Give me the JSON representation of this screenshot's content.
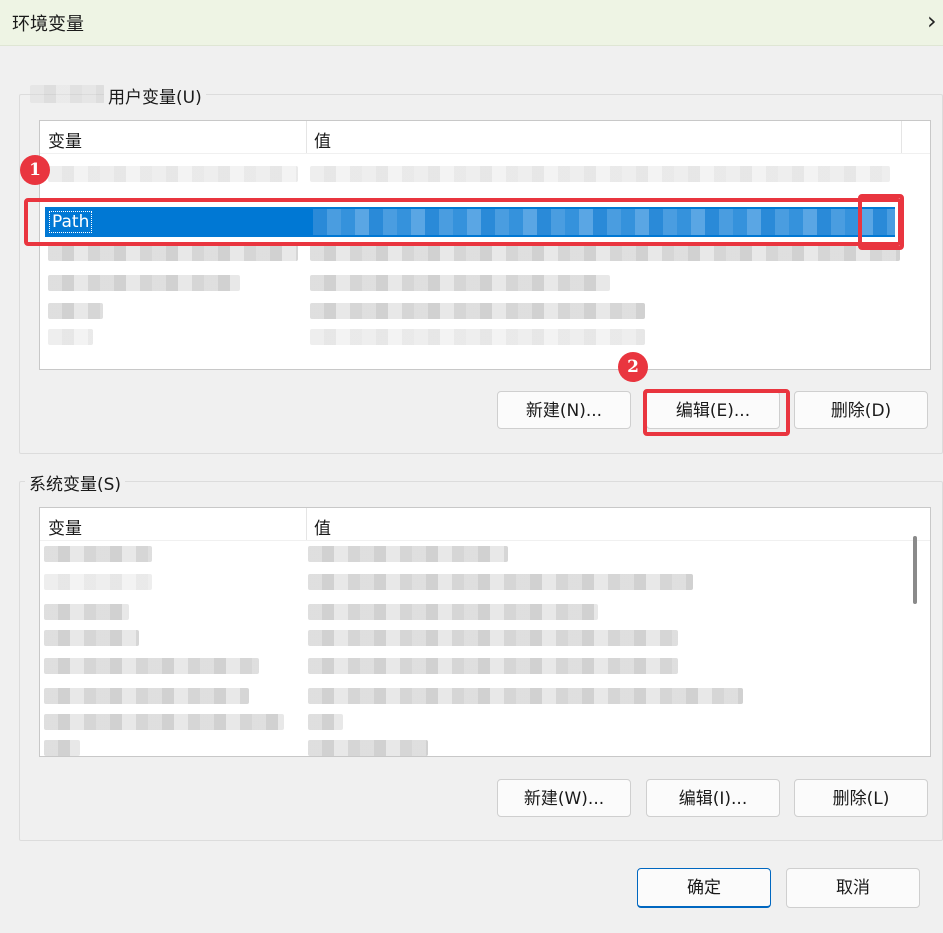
{
  "window": {
    "title": "环境变量"
  },
  "user_group": {
    "label": "用户变量(U)",
    "columns": [
      "变量",
      "值"
    ],
    "selected_variable": "Path",
    "buttons": {
      "new": "新建(N)...",
      "edit": "编辑(E)...",
      "delete": "删除(D)"
    }
  },
  "system_group": {
    "label": "系统变量(S)",
    "columns": [
      "变量",
      "值"
    ],
    "buttons": {
      "new": "新建(W)...",
      "edit": "编辑(I)...",
      "delete": "删除(L)"
    }
  },
  "dialog_buttons": {
    "ok": "确定",
    "cancel": "取消"
  },
  "annotations": {
    "badge1": "1",
    "badge2": "2"
  },
  "colors": {
    "accent": "#0078d4",
    "annotation": "#e9353f"
  }
}
